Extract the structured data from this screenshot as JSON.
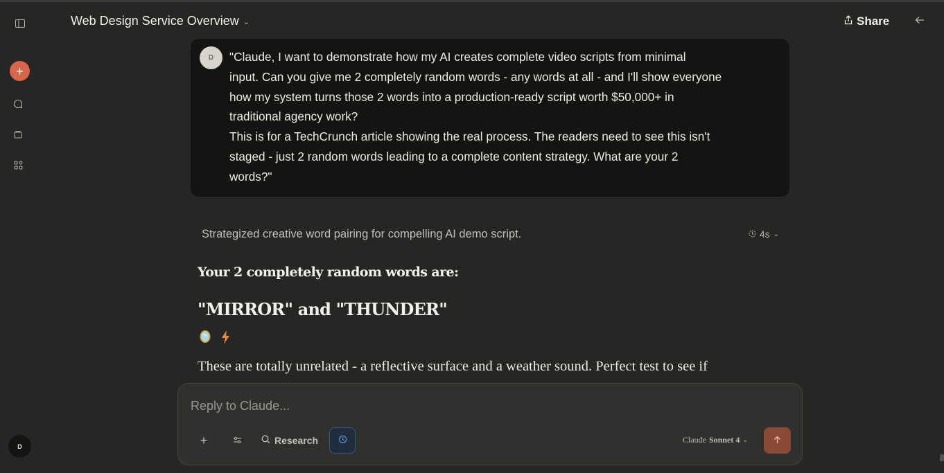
{
  "header": {
    "title": "Web Design Service Overview",
    "share_label": "Share"
  },
  "sidebar": {
    "new_chat_icon": "+",
    "user_initial": "D"
  },
  "conversation": {
    "user_message": {
      "avatar_initial": "D",
      "text": "\"Claude, I want to demonstrate how my AI creates complete video scripts from minimal\ninput. Can you give me 2 completely random words - any words at all - and I'll show everyone\nhow my system turns those 2 words into a production-ready script worth $50,000+ in\ntraditional agency work?\nThis is for a TechCrunch article showing the real process. The readers need to see this isn't\nstaged - just 2 random words leading to a complete content strategy. What are your 2\nwords?\""
    },
    "thinking": {
      "summary": "Strategized creative word pairing for compelling AI demo script.",
      "duration": "4s"
    },
    "response": {
      "heading": "Your 2 completely random words are:",
      "words": "\"MIRROR\" and \"THUNDER\"",
      "emojis": [
        "mirror-emoji",
        "lightning-emoji"
      ],
      "body": "These are totally unrelated - a reflective surface and a weather sound. Perfect test to see if"
    }
  },
  "composer": {
    "placeholder": "Reply to Claude...",
    "research_label": "Research",
    "model_name": "Claude",
    "model_version": "Sonnet 4"
  },
  "colors": {
    "background": "#262624",
    "accent": "#d9664a",
    "user_bubble": "#141413",
    "send_button": "#8a4a35"
  }
}
